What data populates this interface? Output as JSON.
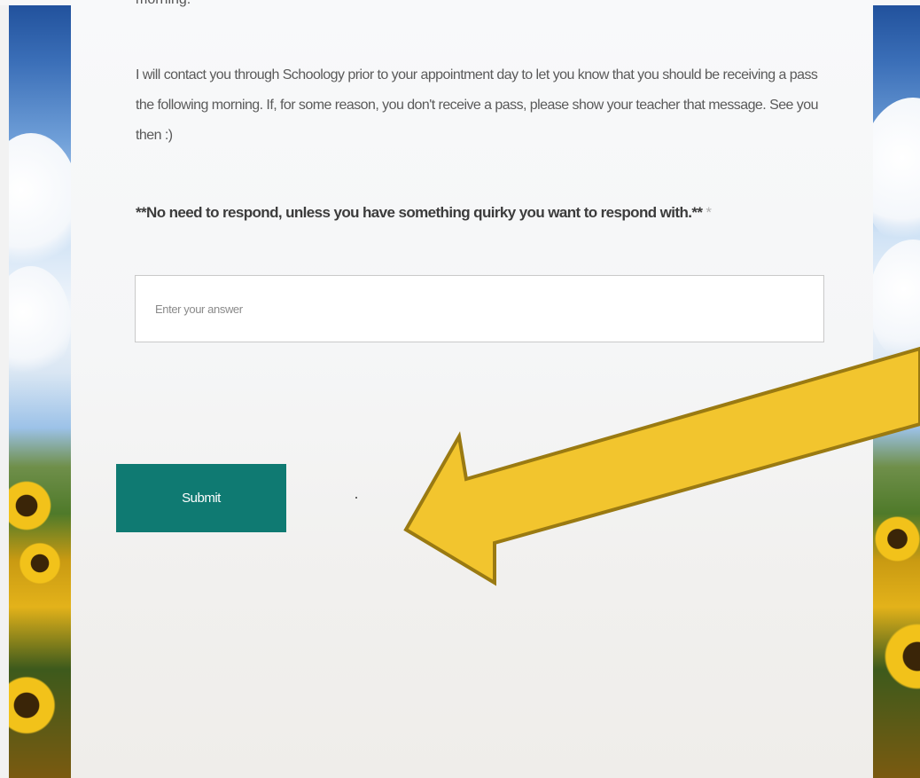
{
  "form": {
    "prev_text": "morning.",
    "body_text": "I will contact you through Schoology prior to your appointment day to let you know that you should be receiving a pass the following morning.  If, for some reason, you don't receive a pass, please show your teacher that message.  See you then :)",
    "question": "**No need to respond, unless you have something quirky you want to respond with.**",
    "required_marker": "*",
    "answer_placeholder": "Enter your answer",
    "answer_value": "",
    "submit_label": "Submit"
  },
  "annotation": {
    "arrow_color": "#f2c52e",
    "arrow_outline_color": "#9a7a12",
    "arrow_points_to": "submit-button"
  },
  "colors": {
    "submit_bg": "#0f7a72",
    "card_bg": "#f6f7f8"
  }
}
